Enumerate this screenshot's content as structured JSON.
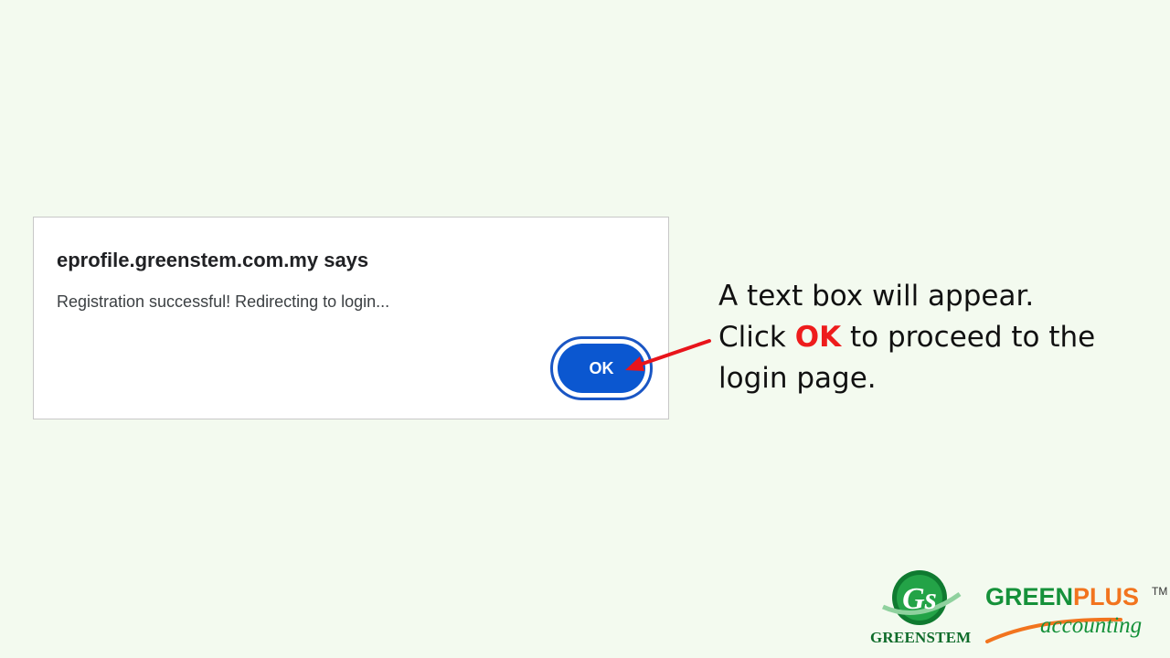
{
  "dialog": {
    "title": "eprofile.greenstem.com.my says",
    "message": "Registration successful! Redirecting to login...",
    "ok_label": "OK"
  },
  "callout": {
    "line1": "A text box will appear.",
    "line2_prefix": "Click ",
    "line2_highlight": "OK",
    "line2_suffix": " to proceed to the",
    "line3": "login page."
  },
  "logos": {
    "greenstem_label": "GREENSTEM",
    "greenstem_monogram": "Gs",
    "greenplus_green": "GREEN",
    "greenplus_plus": "PLUS",
    "greenplus_tm": "TM",
    "greenplus_sub": "accounting"
  },
  "colors": {
    "background": "#f3faef",
    "button": "#0b57d0",
    "highlight": "#ee1c1c",
    "arrow": "#e8141b",
    "brand_green": "#15913a",
    "brand_orange": "#f2741e"
  },
  "icons": {
    "arrow": "arrow-left-icon",
    "greenstem_logo": "greenstem-logo-icon"
  }
}
